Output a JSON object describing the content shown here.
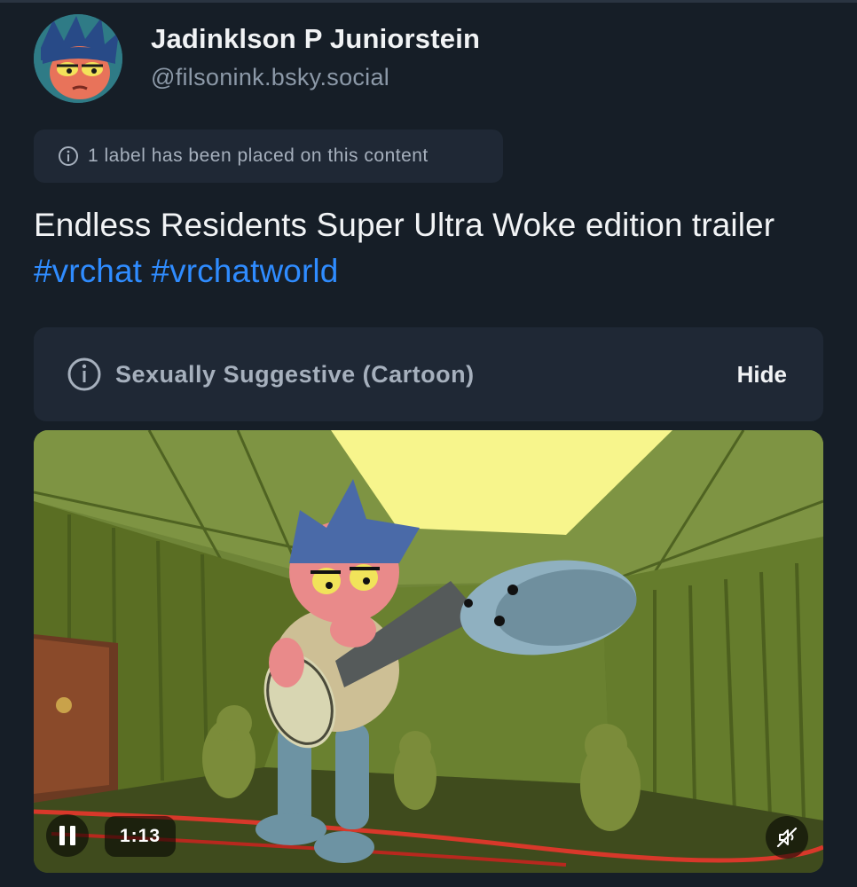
{
  "author": {
    "display_name": "Jadinklson P Juniorstein",
    "handle": "@filsonink.bsky.social",
    "avatar_icon": "avatar-image"
  },
  "label_notice": {
    "text": "1 label has been placed on this content",
    "icon": "info-icon"
  },
  "post": {
    "text": "Endless Residents Super Ultra Woke edition trailer",
    "hashtags": [
      "#vrchat",
      "#vrchatworld"
    ]
  },
  "content_warning": {
    "label": "Sexually Suggestive (Cartoon)",
    "action_label": "Hide",
    "icon": "info-icon"
  },
  "video": {
    "elapsed_time": "1:13",
    "pause_icon": "pause-icon",
    "mute_icon": "muted-speaker-icon"
  },
  "colors": {
    "background": "#161e27",
    "card": "#1f2835",
    "link": "#2f8cff",
    "muted_text": "#8c99a8"
  }
}
